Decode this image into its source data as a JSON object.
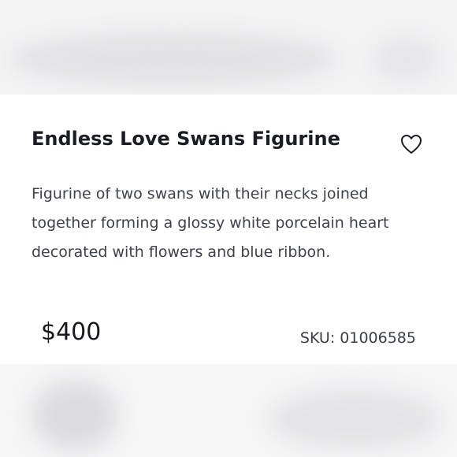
{
  "product": {
    "title": "Endless Love Swans Figurine",
    "description": "Figurine of two swans with their necks joined together forming a glossy white porcelain heart decorated with flowers and blue ribbon.",
    "price": "$400",
    "sku": "SKU: 01006585",
    "favorite_icon": "heart-outline-icon"
  }
}
